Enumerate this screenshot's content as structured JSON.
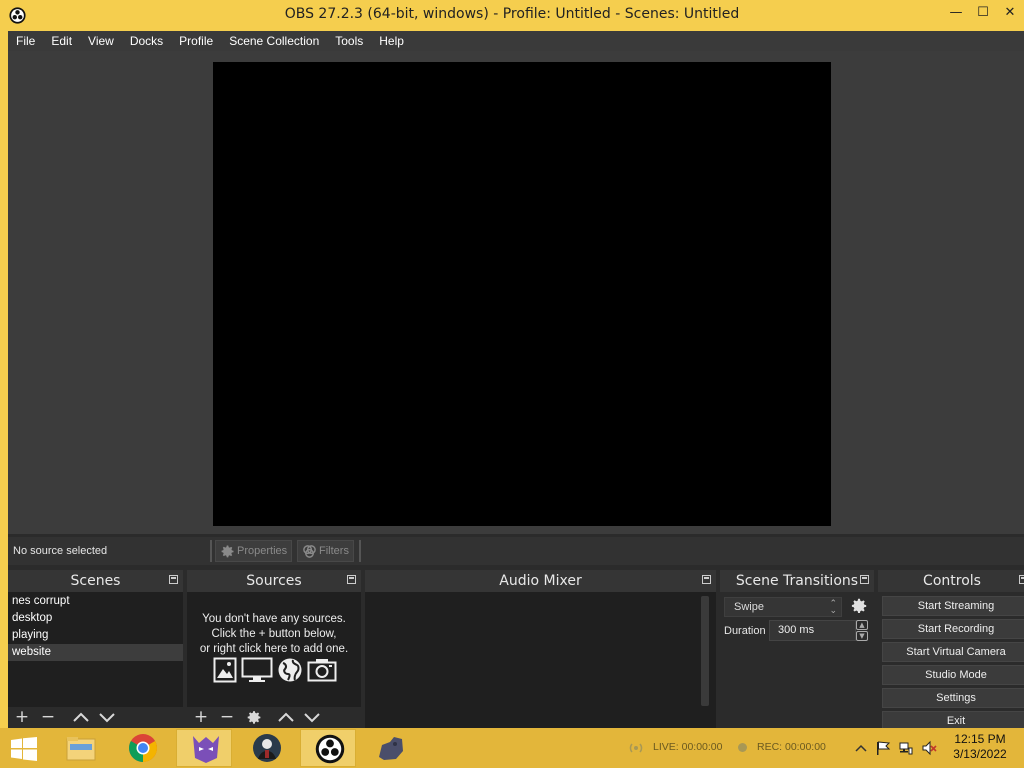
{
  "window": {
    "title": "OBS 27.2.3 (64-bit, windows) - Profile: Untitled - Scenes: Untitled",
    "controls": {
      "minimize": "—",
      "maximize": "☐",
      "close": "✕"
    }
  },
  "menu": [
    "File",
    "Edit",
    "View",
    "Docks",
    "Profile",
    "Scene Collection",
    "Tools",
    "Help"
  ],
  "source_bar": {
    "status": "No source selected",
    "properties_label": "Properties",
    "filters_label": "Filters"
  },
  "docks": {
    "scenes": {
      "title": "Scenes",
      "items": [
        {
          "label": "nes corrupt"
        },
        {
          "label": "desktop"
        },
        {
          "label": "playing"
        },
        {
          "label": "website"
        }
      ],
      "selected_index": 3
    },
    "sources": {
      "title": "Sources",
      "empty_line1": "You don't have any sources.",
      "empty_line2": "Click the + button below,",
      "empty_line3": "or right click here to add one."
    },
    "audio_mixer": {
      "title": "Audio Mixer"
    },
    "scene_transitions": {
      "title": "Scene Transitions",
      "transition": "Swipe",
      "duration_label": "Duration",
      "duration_value": "300 ms"
    },
    "controls": {
      "title": "Controls",
      "buttons": [
        "Start Streaming",
        "Start Recording",
        "Start Virtual Camera",
        "Studio Mode",
        "Settings",
        "Exit"
      ]
    }
  },
  "status": {
    "live": "LIVE: 00:00:00",
    "rec": "REC: 00:00:00"
  },
  "taskbar": {
    "time": "12:15 PM",
    "date": "3/13/2022"
  },
  "colors": {
    "accent_frame": "#f5ce4e",
    "taskbar": "#e3b63a",
    "panel": "#2b2b2b",
    "preview": "#000000"
  }
}
